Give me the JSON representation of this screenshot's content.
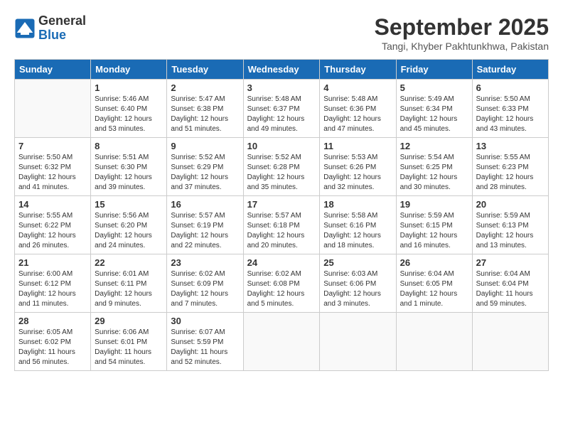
{
  "header": {
    "logo_general": "General",
    "logo_blue": "Blue",
    "month_title": "September 2025",
    "location": "Tangi, Khyber Pakhtunkhwa, Pakistan"
  },
  "weekdays": [
    "Sunday",
    "Monday",
    "Tuesday",
    "Wednesday",
    "Thursday",
    "Friday",
    "Saturday"
  ],
  "weeks": [
    [
      {
        "day": null
      },
      {
        "day": "1",
        "sunrise": "5:46 AM",
        "sunset": "6:40 PM",
        "daylight": "12 hours and 53 minutes."
      },
      {
        "day": "2",
        "sunrise": "5:47 AM",
        "sunset": "6:38 PM",
        "daylight": "12 hours and 51 minutes."
      },
      {
        "day": "3",
        "sunrise": "5:48 AM",
        "sunset": "6:37 PM",
        "daylight": "12 hours and 49 minutes."
      },
      {
        "day": "4",
        "sunrise": "5:48 AM",
        "sunset": "6:36 PM",
        "daylight": "12 hours and 47 minutes."
      },
      {
        "day": "5",
        "sunrise": "5:49 AM",
        "sunset": "6:34 PM",
        "daylight": "12 hours and 45 minutes."
      },
      {
        "day": "6",
        "sunrise": "5:50 AM",
        "sunset": "6:33 PM",
        "daylight": "12 hours and 43 minutes."
      }
    ],
    [
      {
        "day": "7",
        "sunrise": "5:50 AM",
        "sunset": "6:32 PM",
        "daylight": "12 hours and 41 minutes."
      },
      {
        "day": "8",
        "sunrise": "5:51 AM",
        "sunset": "6:30 PM",
        "daylight": "12 hours and 39 minutes."
      },
      {
        "day": "9",
        "sunrise": "5:52 AM",
        "sunset": "6:29 PM",
        "daylight": "12 hours and 37 minutes."
      },
      {
        "day": "10",
        "sunrise": "5:52 AM",
        "sunset": "6:28 PM",
        "daylight": "12 hours and 35 minutes."
      },
      {
        "day": "11",
        "sunrise": "5:53 AM",
        "sunset": "6:26 PM",
        "daylight": "12 hours and 32 minutes."
      },
      {
        "day": "12",
        "sunrise": "5:54 AM",
        "sunset": "6:25 PM",
        "daylight": "12 hours and 30 minutes."
      },
      {
        "day": "13",
        "sunrise": "5:55 AM",
        "sunset": "6:23 PM",
        "daylight": "12 hours and 28 minutes."
      }
    ],
    [
      {
        "day": "14",
        "sunrise": "5:55 AM",
        "sunset": "6:22 PM",
        "daylight": "12 hours and 26 minutes."
      },
      {
        "day": "15",
        "sunrise": "5:56 AM",
        "sunset": "6:20 PM",
        "daylight": "12 hours and 24 minutes."
      },
      {
        "day": "16",
        "sunrise": "5:57 AM",
        "sunset": "6:19 PM",
        "daylight": "12 hours and 22 minutes."
      },
      {
        "day": "17",
        "sunrise": "5:57 AM",
        "sunset": "6:18 PM",
        "daylight": "12 hours and 20 minutes."
      },
      {
        "day": "18",
        "sunrise": "5:58 AM",
        "sunset": "6:16 PM",
        "daylight": "12 hours and 18 minutes."
      },
      {
        "day": "19",
        "sunrise": "5:59 AM",
        "sunset": "6:15 PM",
        "daylight": "12 hours and 16 minutes."
      },
      {
        "day": "20",
        "sunrise": "5:59 AM",
        "sunset": "6:13 PM",
        "daylight": "12 hours and 13 minutes."
      }
    ],
    [
      {
        "day": "21",
        "sunrise": "6:00 AM",
        "sunset": "6:12 PM",
        "daylight": "12 hours and 11 minutes."
      },
      {
        "day": "22",
        "sunrise": "6:01 AM",
        "sunset": "6:11 PM",
        "daylight": "12 hours and 9 minutes."
      },
      {
        "day": "23",
        "sunrise": "6:02 AM",
        "sunset": "6:09 PM",
        "daylight": "12 hours and 7 minutes."
      },
      {
        "day": "24",
        "sunrise": "6:02 AM",
        "sunset": "6:08 PM",
        "daylight": "12 hours and 5 minutes."
      },
      {
        "day": "25",
        "sunrise": "6:03 AM",
        "sunset": "6:06 PM",
        "daylight": "12 hours and 3 minutes."
      },
      {
        "day": "26",
        "sunrise": "6:04 AM",
        "sunset": "6:05 PM",
        "daylight": "12 hours and 1 minute."
      },
      {
        "day": "27",
        "sunrise": "6:04 AM",
        "sunset": "6:04 PM",
        "daylight": "11 hours and 59 minutes."
      }
    ],
    [
      {
        "day": "28",
        "sunrise": "6:05 AM",
        "sunset": "6:02 PM",
        "daylight": "11 hours and 56 minutes."
      },
      {
        "day": "29",
        "sunrise": "6:06 AM",
        "sunset": "6:01 PM",
        "daylight": "11 hours and 54 minutes."
      },
      {
        "day": "30",
        "sunrise": "6:07 AM",
        "sunset": "5:59 PM",
        "daylight": "11 hours and 52 minutes."
      },
      {
        "day": null
      },
      {
        "day": null
      },
      {
        "day": null
      },
      {
        "day": null
      }
    ]
  ]
}
